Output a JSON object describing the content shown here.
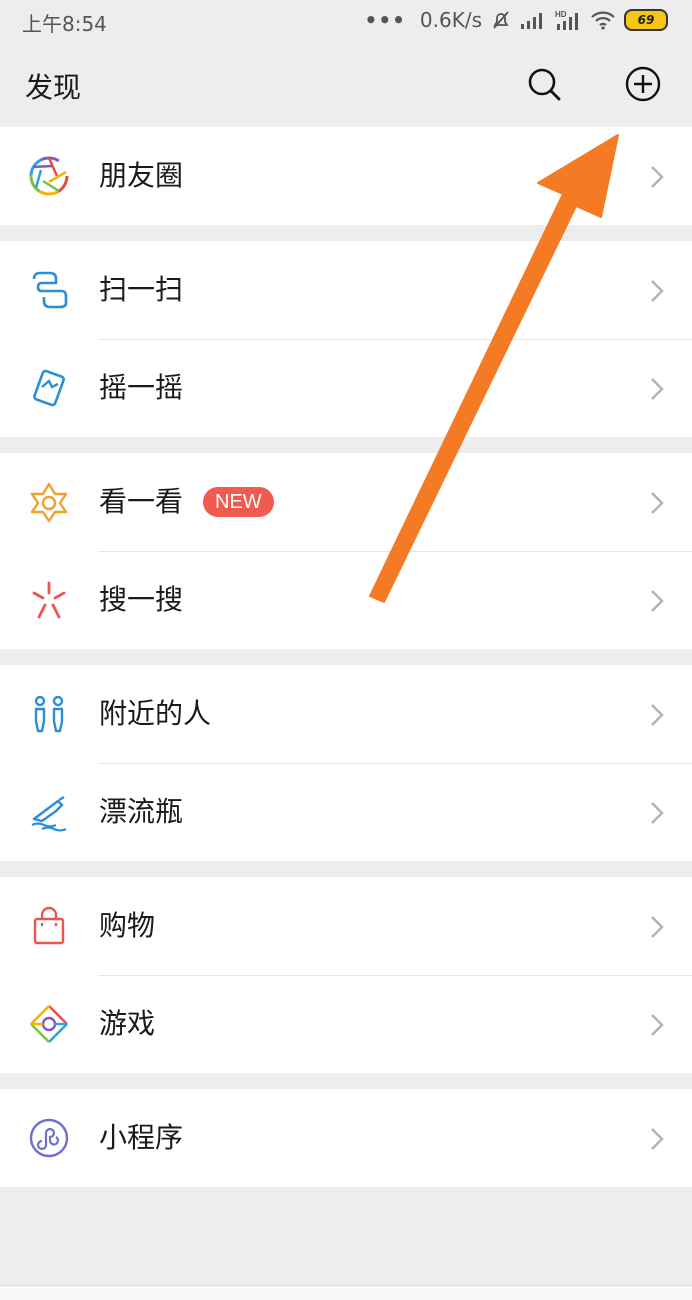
{
  "status": {
    "time": "上午8:54",
    "dots": "•••",
    "speed": "0.6K/s",
    "battery": "69"
  },
  "header": {
    "title": "发现"
  },
  "menu": {
    "moments": "朋友圈",
    "scan": "扫一扫",
    "shake": "摇一摇",
    "top_stories": "看一看",
    "top_stories_badge": "NEW",
    "search": "搜一搜",
    "people_nearby": "附近的人",
    "drift_bottle": "漂流瓶",
    "shopping": "购物",
    "games": "游戏",
    "mini_programs": "小程序"
  },
  "colors": {
    "annotation_arrow": "#f47a24",
    "badge": "#f05a4f",
    "icon_blue": "#2a8fd8",
    "icon_orange": "#f0a030",
    "icon_red": "#e8574e",
    "icon_purple": "#6f6fd0"
  }
}
